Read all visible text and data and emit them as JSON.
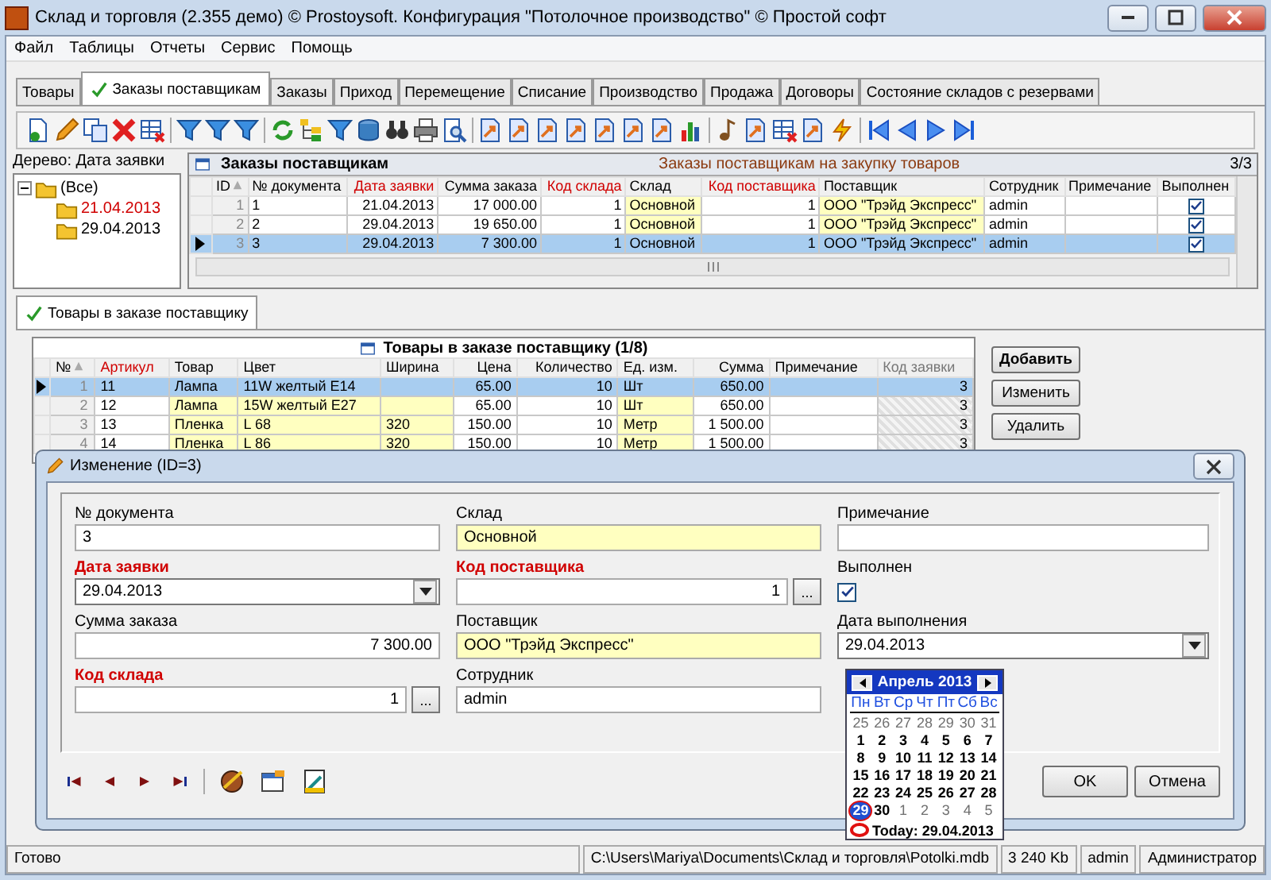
{
  "window": {
    "title": "Склад и торговля (2.355 демо) © Prostoysoft. Конфигурация \"Потолочное производство\" © Простой софт"
  },
  "menu": [
    "Файл",
    "Таблицы",
    "Отчеты",
    "Сервис",
    "Помощь"
  ],
  "tabs": [
    {
      "label": "Товары",
      "selected": false
    },
    {
      "label": "Заказы поставщикам",
      "selected": true
    },
    {
      "label": "Заказы",
      "selected": false
    },
    {
      "label": "Приход",
      "selected": false
    },
    {
      "label": "Перемещение",
      "selected": false
    },
    {
      "label": "Списание",
      "selected": false
    },
    {
      "label": "Производство",
      "selected": false
    },
    {
      "label": "Продажа",
      "selected": false
    },
    {
      "label": "Договоры",
      "selected": false
    },
    {
      "label": "Состояние складов с резервами",
      "selected": false
    }
  ],
  "tree": {
    "title": "Дерево: Дата заявки",
    "root": {
      "label": "(Все)",
      "expanded": true,
      "children": [
        {
          "label": "21.04.2013",
          "selected": true
        },
        {
          "label": "29.04.2013",
          "selected": false
        }
      ]
    }
  },
  "orders": {
    "title": "Заказы поставщикам",
    "subtitle": "Заказы поставщикам на закупку товаров",
    "count": "3/3",
    "columns": [
      {
        "label": "ID",
        "kind": "id",
        "sorted": true
      },
      {
        "label": "№ документа",
        "kind": "text",
        "sorted": false
      },
      {
        "label": "Дата заявки",
        "kind": "num",
        "required": true,
        "sorted": false
      },
      {
        "label": "Сумма заказа",
        "kind": "num",
        "sorted": false
      },
      {
        "label": "Код склада",
        "kind": "num",
        "required": true,
        "sorted": false
      },
      {
        "label": "Склад",
        "kind": "lookup",
        "sorted": false
      },
      {
        "label": "Код поставщика",
        "kind": "num",
        "required": true,
        "sorted": false
      },
      {
        "label": "Поставщик",
        "kind": "lookup",
        "sorted": false
      },
      {
        "label": "Сотрудник",
        "kind": "text",
        "sorted": false
      },
      {
        "label": "Примечание",
        "kind": "text",
        "sorted": false
      },
      {
        "label": "Выполнен",
        "kind": "check",
        "sorted": false
      }
    ],
    "rows": [
      {
        "cells": [
          "1",
          "1",
          "21.04.2013",
          "17 000.00",
          "1",
          "Основной",
          "1",
          "ООО \"Трэйд Экспресс\"",
          "admin",
          null
        ],
        "done": true,
        "selected": false
      },
      {
        "cells": [
          "2",
          "2",
          "29.04.2013",
          "19 650.00",
          "1",
          "Основной",
          "1",
          "ООО \"Трэйд Экспресс\"",
          "admin",
          null
        ],
        "done": true,
        "selected": false
      },
      {
        "cells": [
          "3",
          "3",
          "29.04.2013",
          "7 300.00",
          "1",
          "Основной",
          "1",
          "ООО \"Трэйд Экспресс\"",
          "admin",
          null
        ],
        "done": true,
        "selected": true
      }
    ]
  },
  "items_tab": {
    "label": "Товары в заказе поставщику",
    "selected": true
  },
  "items": {
    "title": "Товары в заказе поставщику (1/8)",
    "columns": [
      {
        "label": "№",
        "kind": "id",
        "sorted": true
      },
      {
        "label": "Артикул",
        "kind": "text",
        "required": true,
        "sorted": false
      },
      {
        "label": "Товар",
        "kind": "lookup",
        "sorted": false
      },
      {
        "label": "Цвет",
        "kind": "lookup",
        "sorted": false
      },
      {
        "label": "Ширина",
        "kind": "lookup",
        "sorted": false
      },
      {
        "label": "Цена",
        "kind": "num",
        "sorted": false
      },
      {
        "label": "Количество",
        "kind": "num",
        "sorted": false
      },
      {
        "label": "Ед. изм.",
        "kind": "lookup",
        "sorted": false
      },
      {
        "label": "Сумма",
        "kind": "num",
        "sorted": false
      },
      {
        "label": "Примечание",
        "kind": "text",
        "sorted": false
      },
      {
        "label": "Код заявки",
        "kind": "readonly",
        "sorted": false
      }
    ],
    "rows": [
      {
        "cells": [
          "1",
          "11",
          "Лампа",
          "11W желтый  E14",
          null,
          "65.00",
          "10",
          "Шт",
          "650.00",
          null,
          "3"
        ],
        "selected": true
      },
      {
        "cells": [
          "2",
          "12",
          "Лампа",
          "15W желтый E27",
          null,
          "65.00",
          "10",
          "Шт",
          "650.00",
          null,
          "3"
        ],
        "selected": false
      },
      {
        "cells": [
          "3",
          "13",
          "Пленка",
          "L 68",
          "320",
          "150.00",
          "10",
          "Метр",
          "1 500.00",
          null,
          "3"
        ],
        "selected": false
      },
      {
        "cells": [
          "4",
          "14",
          "Пленка",
          "L 86",
          "320",
          "150.00",
          "10",
          "Метр",
          "1 500.00",
          null,
          "3"
        ],
        "selected": false
      }
    ],
    "buttons": [
      "Добавить",
      "Изменить",
      "Удалить"
    ]
  },
  "dialog": {
    "title": "Изменение (ID=3)",
    "columns": [
      [
        {
          "label": "№ документа",
          "kind": "text",
          "value": "3"
        },
        {
          "label": "Дата заявки",
          "kind": "combo",
          "value": "29.04.2013",
          "required": true
        },
        {
          "label": "Сумма заказа",
          "kind": "number",
          "value": "7 300.00"
        },
        {
          "label": "Код склада",
          "kind": "lookup",
          "value": "1",
          "required": true,
          "button": "..."
        }
      ],
      [
        {
          "label": "Склад",
          "kind": "text",
          "value": "Основной",
          "highlighted": true
        },
        {
          "label": "Код поставщика",
          "kind": "lookup",
          "value": "1",
          "required": true,
          "button": "..."
        },
        {
          "label": "Поставщик",
          "kind": "text",
          "value": "ООО \"Трэйд Экспресс\"",
          "highlighted": true
        },
        {
          "label": "Сотрудник",
          "kind": "text",
          "value": "admin"
        }
      ],
      [
        {
          "label": "Примечание",
          "kind": "text"
        },
        {
          "label": "Выполнен",
          "kind": "checkbox",
          "checked": true
        },
        {
          "label": "Дата выполнения",
          "kind": "combo",
          "value": "29.04.2013"
        }
      ]
    ],
    "buttons": [
      "OK",
      "Отмена"
    ]
  },
  "calendar": {
    "title": "Апрель 2013",
    "weekdays": [
      "Пн",
      "Вт",
      "Ср",
      "Чт",
      "Пт",
      "Сб",
      "Вс"
    ],
    "days": [
      {
        "text": "25",
        "muted": true,
        "selected": false
      },
      {
        "text": "26",
        "muted": true,
        "selected": false
      },
      {
        "text": "27",
        "muted": true,
        "selected": false
      },
      {
        "text": "28",
        "muted": true,
        "selected": false
      },
      {
        "text": "29",
        "muted": true,
        "selected": false
      },
      {
        "text": "30",
        "muted": true,
        "selected": false
      },
      {
        "text": "31",
        "muted": true,
        "selected": false
      },
      {
        "text": "1",
        "muted": false,
        "selected": false
      },
      {
        "text": "2",
        "muted": false,
        "selected": false
      },
      {
        "text": "3",
        "muted": false,
        "selected": false
      },
      {
        "text": "4",
        "muted": false,
        "selected": false
      },
      {
        "text": "5",
        "muted": false,
        "selected": false
      },
      {
        "text": "6",
        "muted": false,
        "selected": false
      },
      {
        "text": "7",
        "muted": false,
        "selected": false
      },
      {
        "text": "8",
        "muted": false,
        "selected": false
      },
      {
        "text": "9",
        "muted": false,
        "selected": false
      },
      {
        "text": "10",
        "muted": false,
        "selected": false
      },
      {
        "text": "11",
        "muted": false,
        "selected": false
      },
      {
        "text": "12",
        "muted": false,
        "selected": false
      },
      {
        "text": "13",
        "muted": false,
        "selected": false
      },
      {
        "text": "14",
        "muted": false,
        "selected": false
      },
      {
        "text": "15",
        "muted": false,
        "selected": false
      },
      {
        "text": "16",
        "muted": false,
        "selected": false
      },
      {
        "text": "17",
        "muted": false,
        "selected": false
      },
      {
        "text": "18",
        "muted": false,
        "selected": false
      },
      {
        "text": "19",
        "muted": false,
        "selected": false
      },
      {
        "text": "20",
        "muted": false,
        "selected": false
      },
      {
        "text": "21",
        "muted": false,
        "selected": false
      },
      {
        "text": "22",
        "muted": false,
        "selected": false
      },
      {
        "text": "23",
        "muted": false,
        "selected": false
      },
      {
        "text": "24",
        "muted": false,
        "selected": false
      },
      {
        "text": "25",
        "muted": false,
        "selected": false
      },
      {
        "text": "26",
        "muted": false,
        "selected": false
      },
      {
        "text": "27",
        "muted": false,
        "selected": false
      },
      {
        "text": "28",
        "muted": false,
        "selected": false
      },
      {
        "text": "29",
        "muted": false,
        "selected": true
      },
      {
        "text": "30",
        "muted": false,
        "selected": false
      },
      {
        "text": "1",
        "muted": true,
        "selected": false
      },
      {
        "text": "2",
        "muted": true,
        "selected": false
      },
      {
        "text": "3",
        "muted": true,
        "selected": false
      },
      {
        "text": "4",
        "muted": true,
        "selected": false
      },
      {
        "text": "5",
        "muted": true,
        "selected": false
      }
    ],
    "today": "Today: 29.04.2013"
  },
  "status_bar": [
    "Готово",
    "C:\\Users\\Mariya\\Documents\\Склад и торговля\\Potolki.mdb",
    "3 240 Kb",
    "admin",
    "Администратор"
  ]
}
